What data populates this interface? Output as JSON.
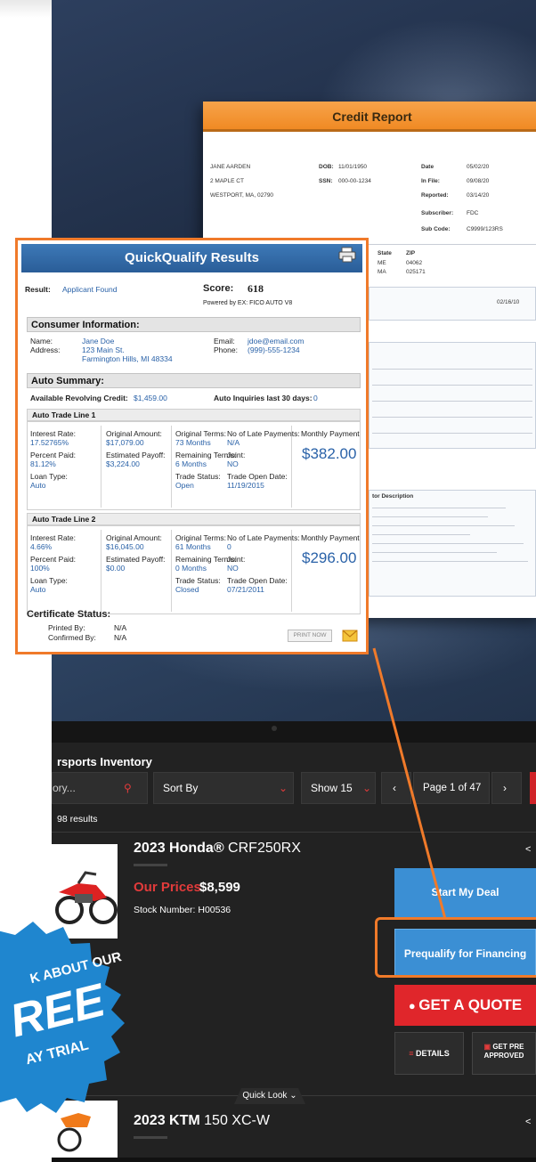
{
  "credit_report": {
    "title": "Credit Report",
    "name": "JANE AARDEN",
    "street": "2 MAPLE CT",
    "city": "WESTPORT, MA, 02790",
    "dob_label": "DOB:",
    "dob": "11/01/1950",
    "ssn_label": "SSN:",
    "ssn": "000-00-1234",
    "date_label": "Date",
    "date": "05/02/20",
    "infile_label": "In File:",
    "infile": "09/08/20",
    "reported_label": "Reported:",
    "reported": "03/14/20",
    "subscriber_label": "Subscriber:",
    "subscriber": "FDC",
    "subcode_label": "Sub Code:",
    "subcode": "C9999/123RS",
    "state_label": "State",
    "zip_label": "ZIP",
    "state1": "ME",
    "zip1": "04062",
    "state2": "MA",
    "zip2": "025171",
    "misc_date": "02/16/10",
    "factor_desc_label": "tor Description"
  },
  "qq": {
    "title": "QuickQualify Results",
    "result_label": "Result:",
    "result_value": "Applicant Found",
    "score_label": "Score:",
    "score_value": "618",
    "powered_by": "Powered by EX: FICO AUTO V8",
    "consumer_header": "Consumer Information:",
    "name_label": "Name:",
    "name_value": "Jane Doe",
    "address_label": "Address:",
    "address_line1": "123 Main St.",
    "address_line2": "Farmington Hills, MI 48334",
    "email_label": "Email:",
    "email_value": "jdoe@email.com",
    "phone_label": "Phone:",
    "phone_value": "(999)-555-1234",
    "auto_header": "Auto Summary:",
    "revolving_label": "Available Revolving Credit:",
    "revolving_value": "$1,459.00",
    "inquiries_label": "Auto Inquiries last 30 days:",
    "inquiries_value": "0",
    "trade_lines": [
      {
        "header": "Auto Trade Line 1",
        "interest_label": "Interest Rate:",
        "interest": "17.52765%",
        "orig_amount_label": "Original Amount:",
        "orig_amount": "$17,079.00",
        "orig_terms_label": "Original Terms:",
        "orig_terms": "73 Months",
        "late_label": "No of Late Payments:",
        "late": "N/A",
        "percent_paid_label": "Percent Paid:",
        "percent_paid": "81.12%",
        "payoff_label": "Estimated Payoff:",
        "payoff": "$3,224.00",
        "remaining_label": "Remaining Terms:",
        "remaining": "6 Months",
        "joint_label": "Joint:",
        "joint": "NO",
        "loan_type_label": "Loan Type:",
        "loan_type": "Auto",
        "trade_status_label": "Trade Status:",
        "trade_status": "Open",
        "open_date_label": "Trade Open Date:",
        "open_date": "11/19/2015",
        "monthly_label": "Monthly Payment",
        "monthly": "$382.00"
      },
      {
        "header": "Auto Trade Line 2",
        "interest_label": "Interest Rate:",
        "interest": "4.66%",
        "orig_amount_label": "Original Amount:",
        "orig_amount": "$16,045.00",
        "orig_terms_label": "Original Terms:",
        "orig_terms": "61 Months",
        "late_label": "No of Late Payments:",
        "late": "0",
        "percent_paid_label": "Percent Paid:",
        "percent_paid": "100%",
        "payoff_label": "Estimated Payoff:",
        "payoff": "$0.00",
        "remaining_label": "Remaining Terms:",
        "remaining": "0 Months",
        "joint_label": "Joint:",
        "joint": "NO",
        "loan_type_label": "Loan Type:",
        "loan_type": "Auto",
        "trade_status_label": "Trade Status:",
        "trade_status": "Closed",
        "open_date_label": "Trade Open Date:",
        "open_date": "07/21/2011",
        "monthly_label": "Monthly Payment",
        "monthly": "$296.00"
      }
    ],
    "cert_header": "Certificate Status:",
    "printed_by_label": "Printed By:",
    "printed_by": "N/A",
    "confirmed_by_label": "Confirmed By:",
    "confirmed_by": "N/A",
    "print_now": "PRINT NOW"
  },
  "dealer": {
    "inventory_title": "rsports Inventory",
    "search_placeholder": "ory...",
    "sort_label": "Sort By",
    "show_label": "Show 15",
    "page_label": "Page 1 of 47",
    "results_count": "98 results",
    "item1": {
      "brand": "2023 Honda®",
      "model": " CRF250RX",
      "price_label": "Our Prices",
      "price": "$8,599",
      "stock": "Stock Number: H00536"
    },
    "start_deal": "Start My Deal",
    "prequalify": "Prequalify for Financing",
    "get_quote": "GET A QUOTE",
    "details": "DETAILS",
    "get_approved_1": "GET PRE",
    "get_approved_2": "APPROVED",
    "quick_look": "Quick Look",
    "item2": {
      "brand": "2023 KTM",
      "model": " 150 XC-W"
    }
  },
  "badge": {
    "line1": "K ABOUT OUR",
    "line2": "REE",
    "line3": "AY TRIAL"
  },
  "colors": {
    "accent_orange": "#f07a2a",
    "qq_blue": "#2a62a8",
    "button_blue": "#3b8fd4",
    "quote_red": "#e0262b",
    "badge_blue": "#1f86cf"
  }
}
